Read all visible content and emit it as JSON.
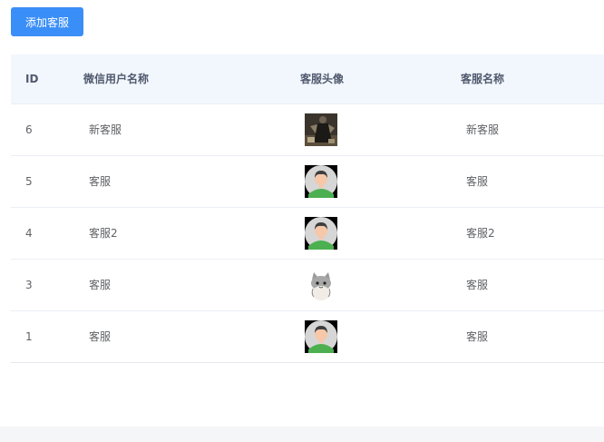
{
  "toolbar": {
    "add_label": "添加客服"
  },
  "table": {
    "headers": {
      "id": "ID",
      "nickname": "微信用户名称",
      "avatar": "客服头像",
      "name": "客服名称"
    },
    "rows": [
      {
        "id": "6",
        "nickname": "新客服",
        "avatar": "dark-warrior-avatar",
        "name": "新客服"
      },
      {
        "id": "5",
        "nickname": "客服",
        "avatar": "default-person-avatar",
        "name": "客服"
      },
      {
        "id": "4",
        "nickname": "客服2",
        "avatar": "default-person-avatar",
        "name": "客服2"
      },
      {
        "id": "3",
        "nickname": "客服",
        "avatar": "cat-avatar",
        "name": "客服"
      },
      {
        "id": "1",
        "nickname": "客服",
        "avatar": "default-person-avatar",
        "name": "客服"
      }
    ]
  }
}
